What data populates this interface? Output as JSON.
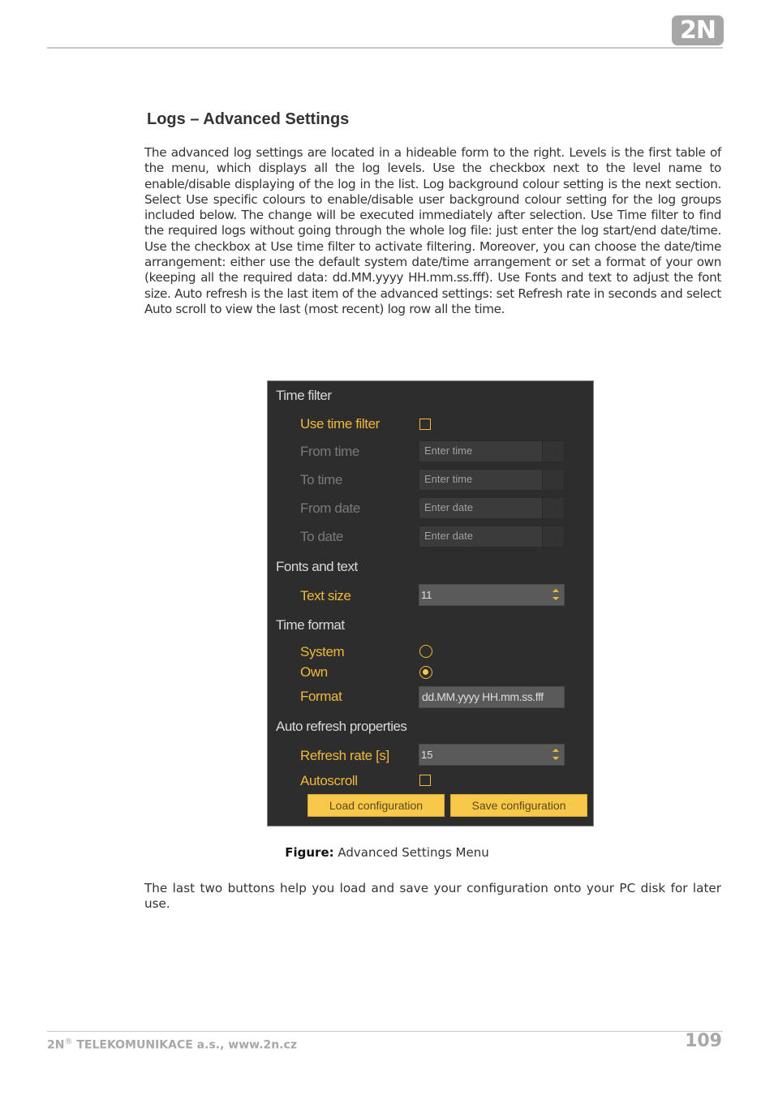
{
  "header": {
    "logo_text": "2N"
  },
  "section": {
    "title": "Logs – Advanced Settings",
    "paragraph1": "The advanced log settings are located in a hideable form to the right. Levels is the first table of the menu, which displays all the log levels. Use the checkbox next to the level name to enable/disable displaying of the log in the list. Log background colour setting is the next section. Select Use specific colours to enable/disable user background colour setting for the log groups included below. The change will be executed immediately after selection. Use Time filter to find the required logs without going through the whole log file: just enter the log start/end date/time. Use the checkbox at Use time filter to activate filtering. Moreover, you can choose the date/time arrangement: either use the default system date/time arrangement or set a format of your own (keeping all the required data: dd.MM.yyyy HH.mm.ss.fff). Use Fonts and text to adjust the font size. Auto refresh is the last item of the advanced settings: set Refresh rate in seconds and select Auto scroll to view the last (most recent) log row all the time.",
    "paragraph2": "The last two buttons help you load and save your configuration onto your PC disk for later use."
  },
  "panel": {
    "time_filter": {
      "heading": "Time filter",
      "use_time_filter_label": "Use time filter",
      "use_time_filter_checked": false,
      "from_time_label": "From time",
      "from_time_placeholder": "Enter time",
      "to_time_label": "To time",
      "to_time_placeholder": "Enter time",
      "from_date_label": "From date",
      "from_date_placeholder": "Enter date",
      "to_date_label": "To date",
      "to_date_placeholder": "Enter date"
    },
    "fonts": {
      "heading": "Fonts and text",
      "text_size_label": "Text size",
      "text_size_value": "11"
    },
    "time_format": {
      "heading": "Time format",
      "system_label": "System",
      "own_label": "Own",
      "selected": "Own",
      "format_label": "Format",
      "format_value": "dd.MM.yyyy HH.mm.ss.fff"
    },
    "auto_refresh": {
      "heading": "Auto refresh properties",
      "refresh_rate_label": "Refresh rate [s]",
      "refresh_rate_value": "15",
      "autoscroll_label": "Autoscroll",
      "autoscroll_checked": false
    },
    "buttons": {
      "load": "Load configuration",
      "save": "Save configuration"
    },
    "colors": {
      "accent": "#f0b93a",
      "panel_bg": "#2d2d2d",
      "button_bg": "#f7c84a"
    }
  },
  "figure": {
    "label": "Figure:",
    "caption": "Advanced Settings Menu"
  },
  "footer": {
    "company_prefix": "2N",
    "registered_mark": "®",
    "company_rest": " TELEKOMUNIKACE a.s., www.2n.cz",
    "page_number": "109"
  }
}
